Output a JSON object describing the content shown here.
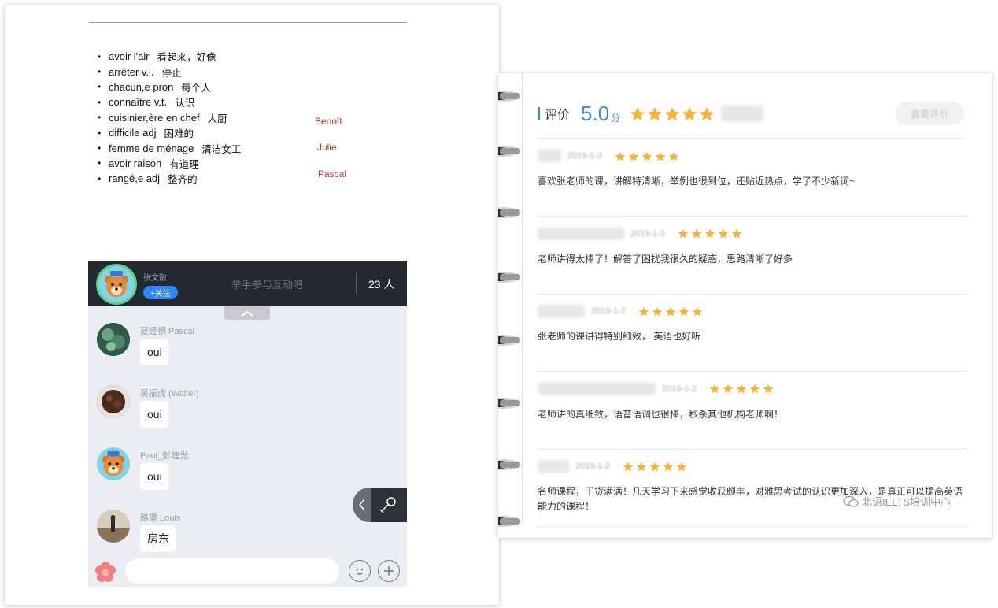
{
  "vocab": [
    {
      "fr": "avoir l'air",
      "zh": "看起来，好像"
    },
    {
      "fr": "arrêter   v.i.",
      "zh": "停止"
    },
    {
      "fr": "chacun,e    pron",
      "zh": "每个人"
    },
    {
      "fr": "connaître  v.t.",
      "zh": "认识"
    },
    {
      "fr": "cuisinier,ère en chef",
      "zh": "大厨"
    },
    {
      "fr": "difficile  adj",
      "zh": "困难的"
    },
    {
      "fr": "femme de ménage",
      "zh": "清洁女工"
    },
    {
      "fr": "avoir raison",
      "zh": "有道理"
    },
    {
      "fr": "rangé,e    adj",
      "zh": "整齐的"
    }
  ],
  "names": [
    "Benoît",
    "Julie",
    "Pascal"
  ],
  "live": {
    "host_name": "张文敬",
    "follow_label": "+关注",
    "raise_hand": "举手参与互动吧",
    "online": "23 人"
  },
  "messages": [
    {
      "sender": "夏经钢 Pascal",
      "text": "oui",
      "avatar": "plant-photo"
    },
    {
      "sender": "吴振虎 (Walter)",
      "text": "oui",
      "avatar": "food-photo"
    },
    {
      "sender": "Paul_彭建光",
      "text": "oui",
      "avatar": "bear-avatar"
    },
    {
      "sender": "路健 Louis",
      "text": "房东",
      "avatar": "landscape-photo"
    }
  ],
  "input": {
    "badge": "1",
    "placeholder": ""
  },
  "rating": {
    "label": "评价",
    "score": "5.0",
    "unit": "分",
    "button": "我要评价"
  },
  "reviews": [
    {
      "date": "2019-1-3",
      "text": "喜欢张老师的课，讲解特清晰，举例也很到位，还贴近热点，学了不少新词~"
    },
    {
      "date": "2019-1-3",
      "text": "老师讲得太棒了！解答了困扰我很久的疑惑，思路清晰了好多"
    },
    {
      "date": "2019-1-2",
      "text": "张老师的课讲得特别细致， 英语也好听"
    },
    {
      "date": "2019-1-2",
      "text": "老师讲的真细致，语音语调也很棒，秒杀其他机构老师啊！"
    },
    {
      "date": "2019-1-2",
      "text": "名师课程，干货满满！几天学习下来感觉收获颇丰，对雅思考试的认识更加深入，是真正可以提高英语能力的课程！"
    }
  ],
  "watermark": "北语IELTS培训中心",
  "colors": {
    "accent_blue": "#3b8fc8",
    "star": "#f5b236",
    "red_name": "#c0392b",
    "live_bar": "#242830"
  }
}
